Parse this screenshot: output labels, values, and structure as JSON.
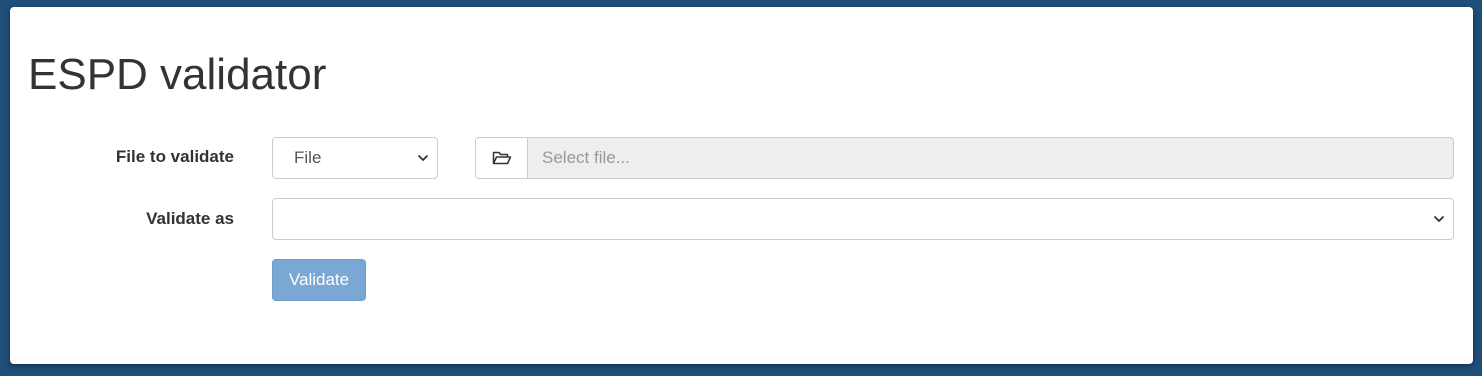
{
  "page": {
    "title": "ESPD validator"
  },
  "form": {
    "file_label": "File to validate",
    "file_type_select": {
      "selected": "File",
      "icon": "chevron-down-icon"
    },
    "file_picker": {
      "icon": "folder-open-icon",
      "placeholder": "Select file..."
    },
    "validate_as_label": "Validate as",
    "validate_as_select": {
      "selected": "",
      "icon": "chevron-down-icon"
    },
    "validate_button": "Validate"
  },
  "colors": {
    "background": "#1f4e79",
    "panel": "#ffffff",
    "button": "#7ba7d4",
    "input_disabled": "#eeeeee"
  }
}
